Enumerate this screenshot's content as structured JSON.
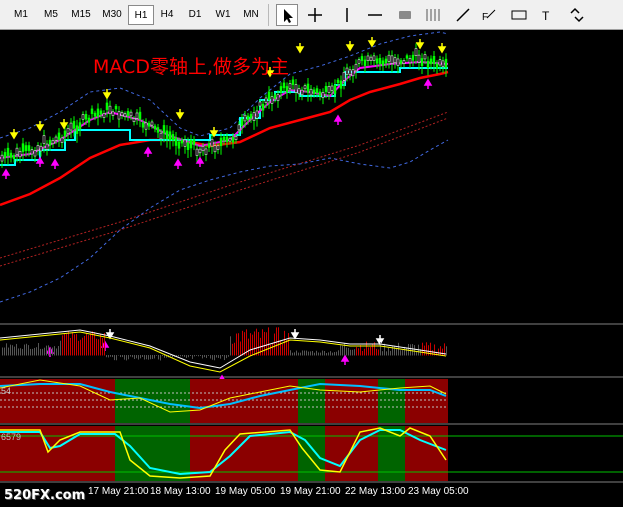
{
  "timeframes": [
    "M1",
    "M5",
    "M15",
    "M30",
    "H1",
    "H4",
    "D1",
    "W1",
    "MN"
  ],
  "active_timeframe": "H1",
  "tools": [
    "cursor-icon",
    "crosshair-icon",
    "vertical-line-icon",
    "horizontal-line-icon",
    "rectangle-icon",
    "channel-icon",
    "trendline-icon",
    "fibonacci-icon",
    "label-icon",
    "text-icon",
    "arrows-icon"
  ],
  "annotation": "MACD零轴上,做多为主",
  "pane_labels": {
    "indicator_2": "54",
    "indicator_3": "6579"
  },
  "time_axis": [
    "17 May 21:00",
    "18 May 13:00",
    "19 May 05:00",
    "19 May 21:00",
    "22 May 13:00",
    "23 May 05:00"
  ],
  "watermark": "520FX.com",
  "colors": {
    "background": "#000000",
    "bull_candle": "#00ff00",
    "bear_candle": "#ffffff",
    "ma_red": "#ff0000",
    "ma_cyan": "#00ffff",
    "ma_magenta": "#ff00ff",
    "bands": "#4169e1",
    "arrow_up": "#ff00ff",
    "arrow_down": "#ffff00",
    "zone_bull": "#006400",
    "zone_bear": "#8b0000"
  }
}
